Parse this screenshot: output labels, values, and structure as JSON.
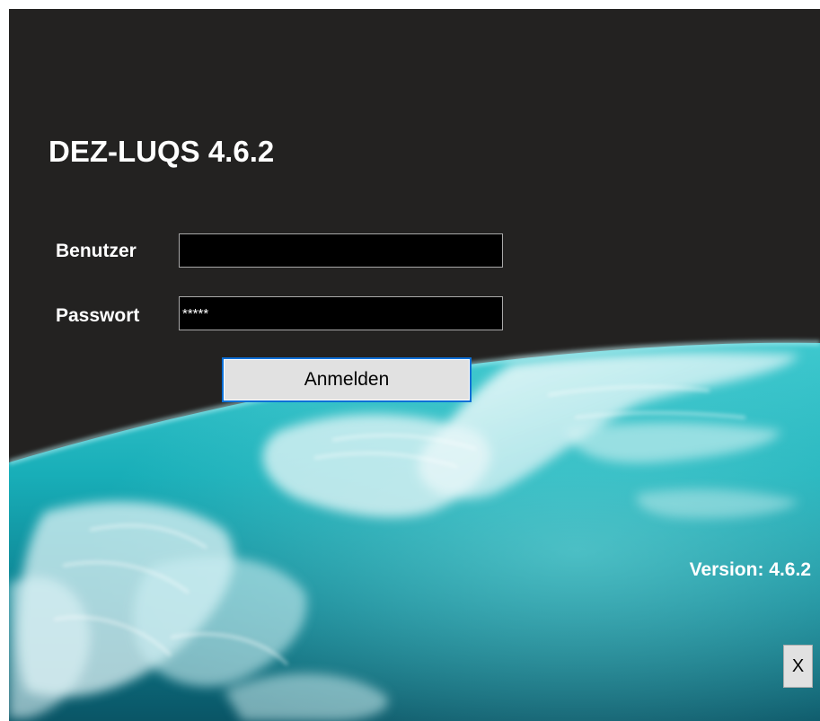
{
  "app": {
    "title": "DEZ-LUQS 4.6.2",
    "version_text": "Version: 4.6.2"
  },
  "login": {
    "user_label": "Benutzer",
    "user_value": "",
    "password_label": "Passwort",
    "password_value": "*****",
    "submit_label": "Anmelden"
  },
  "window": {
    "close_label": "X"
  },
  "colors": {
    "space_background": "#232221",
    "ocean": "#1fb6bf",
    "focus_border": "#0a6fd6"
  },
  "icons": {
    "background_image": "earth-from-orbit-image"
  }
}
